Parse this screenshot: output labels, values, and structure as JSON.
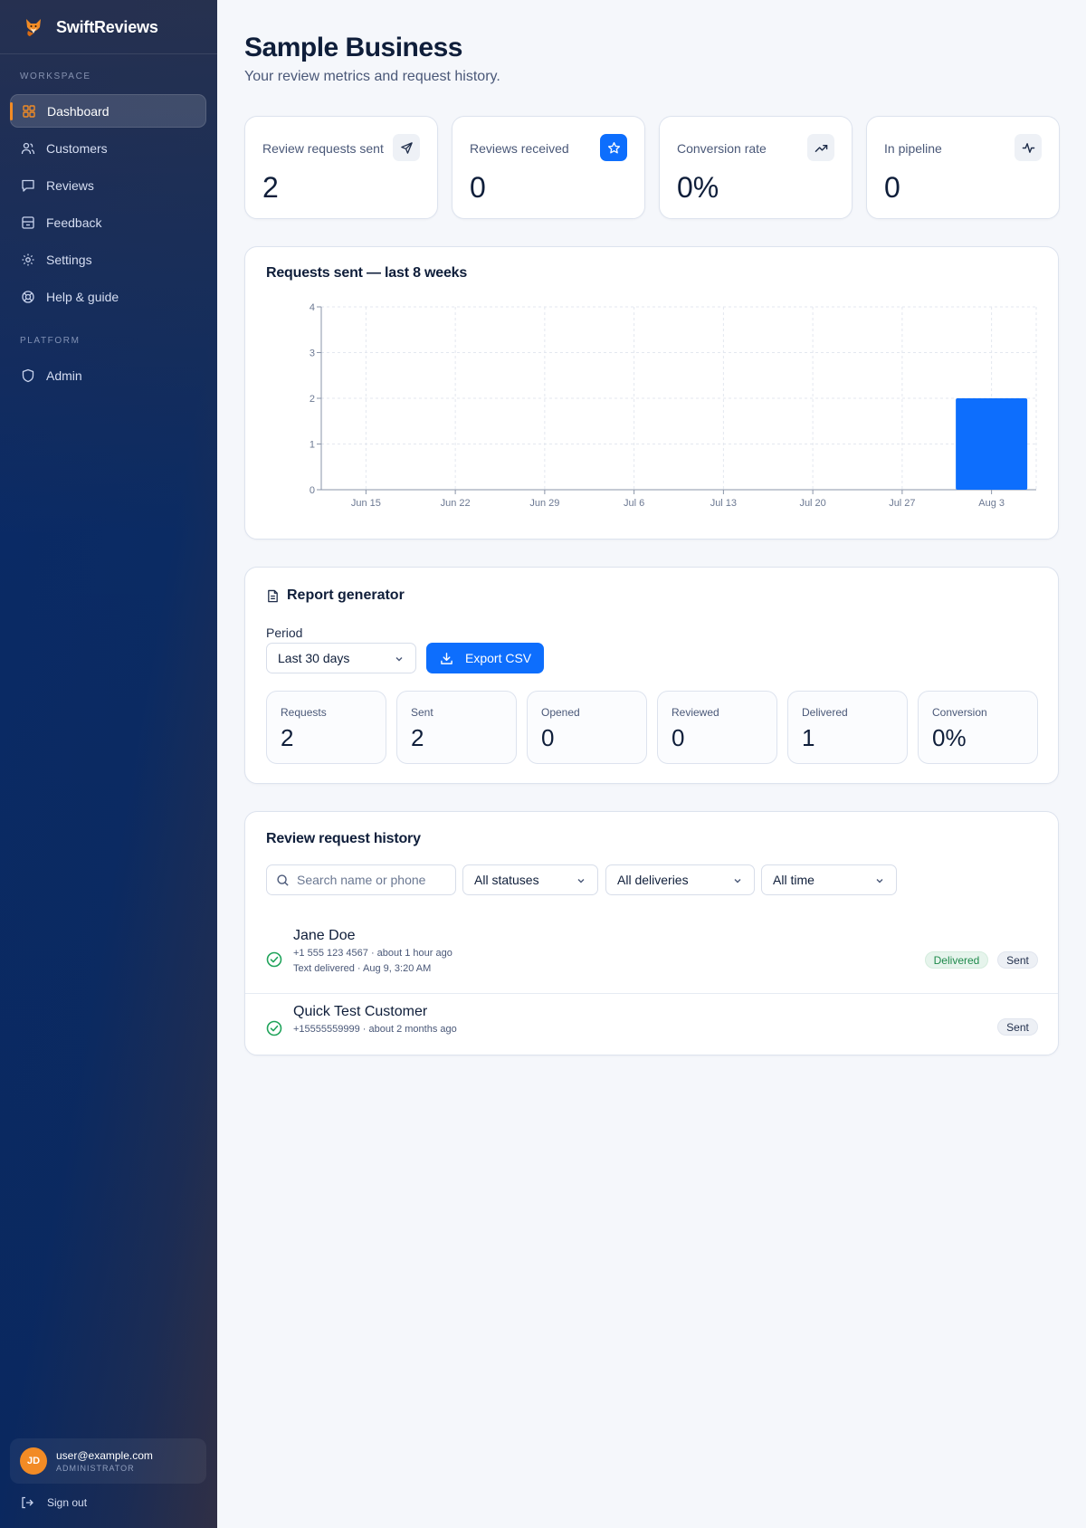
{
  "brand": {
    "name": "SwiftReviews"
  },
  "sidebar": {
    "workspace_label": "WORKSPACE",
    "platform_label": "PLATFORM",
    "items": [
      {
        "label": "Dashboard",
        "icon": "grid-icon",
        "active": true
      },
      {
        "label": "Customers",
        "icon": "users-icon"
      },
      {
        "label": "Reviews",
        "icon": "message-square-icon"
      },
      {
        "label": "Feedback",
        "icon": "inbox-icon"
      },
      {
        "label": "Settings",
        "icon": "gear-icon"
      },
      {
        "label": "Help & guide",
        "icon": "lifebuoy-icon"
      }
    ],
    "platform_items": [
      {
        "label": "Admin",
        "icon": "shield-icon"
      }
    ],
    "user": {
      "initials": "JD",
      "email": "user@example.com",
      "role": "ADMINISTRATOR"
    },
    "signout_label": "Sign out"
  },
  "header": {
    "title": "Sample Business",
    "subtitle": "Your review metrics and request history."
  },
  "stats": [
    {
      "label": "Review requests sent",
      "value": "2",
      "icon": "send-icon"
    },
    {
      "label": "Reviews received",
      "value": "0",
      "icon": "star-icon"
    },
    {
      "label": "Conversion rate",
      "value": "0%",
      "icon": "trending-up-icon"
    },
    {
      "label": "In pipeline",
      "value": "0",
      "icon": "activity-icon"
    }
  ],
  "chart_section": {
    "title": "Requests sent — last 8 weeks"
  },
  "chart_data": {
    "type": "bar",
    "title": "Requests sent — last 8 weeks",
    "categories": [
      "Jun 15",
      "Jun 22",
      "Jun 29",
      "Jul 6",
      "Jul 13",
      "Jul 20",
      "Jul 27",
      "Aug 3"
    ],
    "values": [
      0,
      0,
      0,
      0,
      0,
      0,
      0,
      2
    ],
    "ylim": [
      0,
      4
    ],
    "yticks": [
      "0",
      "1",
      "2",
      "3",
      "4"
    ],
    "xlabel": "",
    "ylabel": "",
    "grid": true,
    "bar_color": "#0d6efd"
  },
  "report": {
    "title": "Report generator",
    "period_label": "Period",
    "period_value": "Last 30 days",
    "export_label": "Export CSV",
    "metrics": [
      {
        "label": "Requests",
        "value": "2"
      },
      {
        "label": "Sent",
        "value": "2"
      },
      {
        "label": "Opened",
        "value": "0"
      },
      {
        "label": "Reviewed",
        "value": "0"
      },
      {
        "label": "Delivered",
        "value": "1"
      },
      {
        "label": "Conversion",
        "value": "0%"
      }
    ]
  },
  "history": {
    "title": "Review request history",
    "search_placeholder": "Search name or phone",
    "filters": {
      "status": "All statuses",
      "delivery": "All deliveries",
      "time": "All time"
    },
    "rows": [
      {
        "name": "Jane Doe",
        "meta": "+1 555 123 4567 · about 1 hour ago",
        "detail": "Text delivered · Aug 9, 3:20 AM",
        "delivery_badge": "Delivered",
        "status_badge": "Sent"
      },
      {
        "name": "Quick Test Customer",
        "meta": "+15555559999 · about 2 months ago",
        "status_badge": "Sent"
      }
    ]
  },
  "colors": {
    "accent": "#0d6efd",
    "brand_orange": "#f28b25",
    "success": "#1fa35a"
  }
}
